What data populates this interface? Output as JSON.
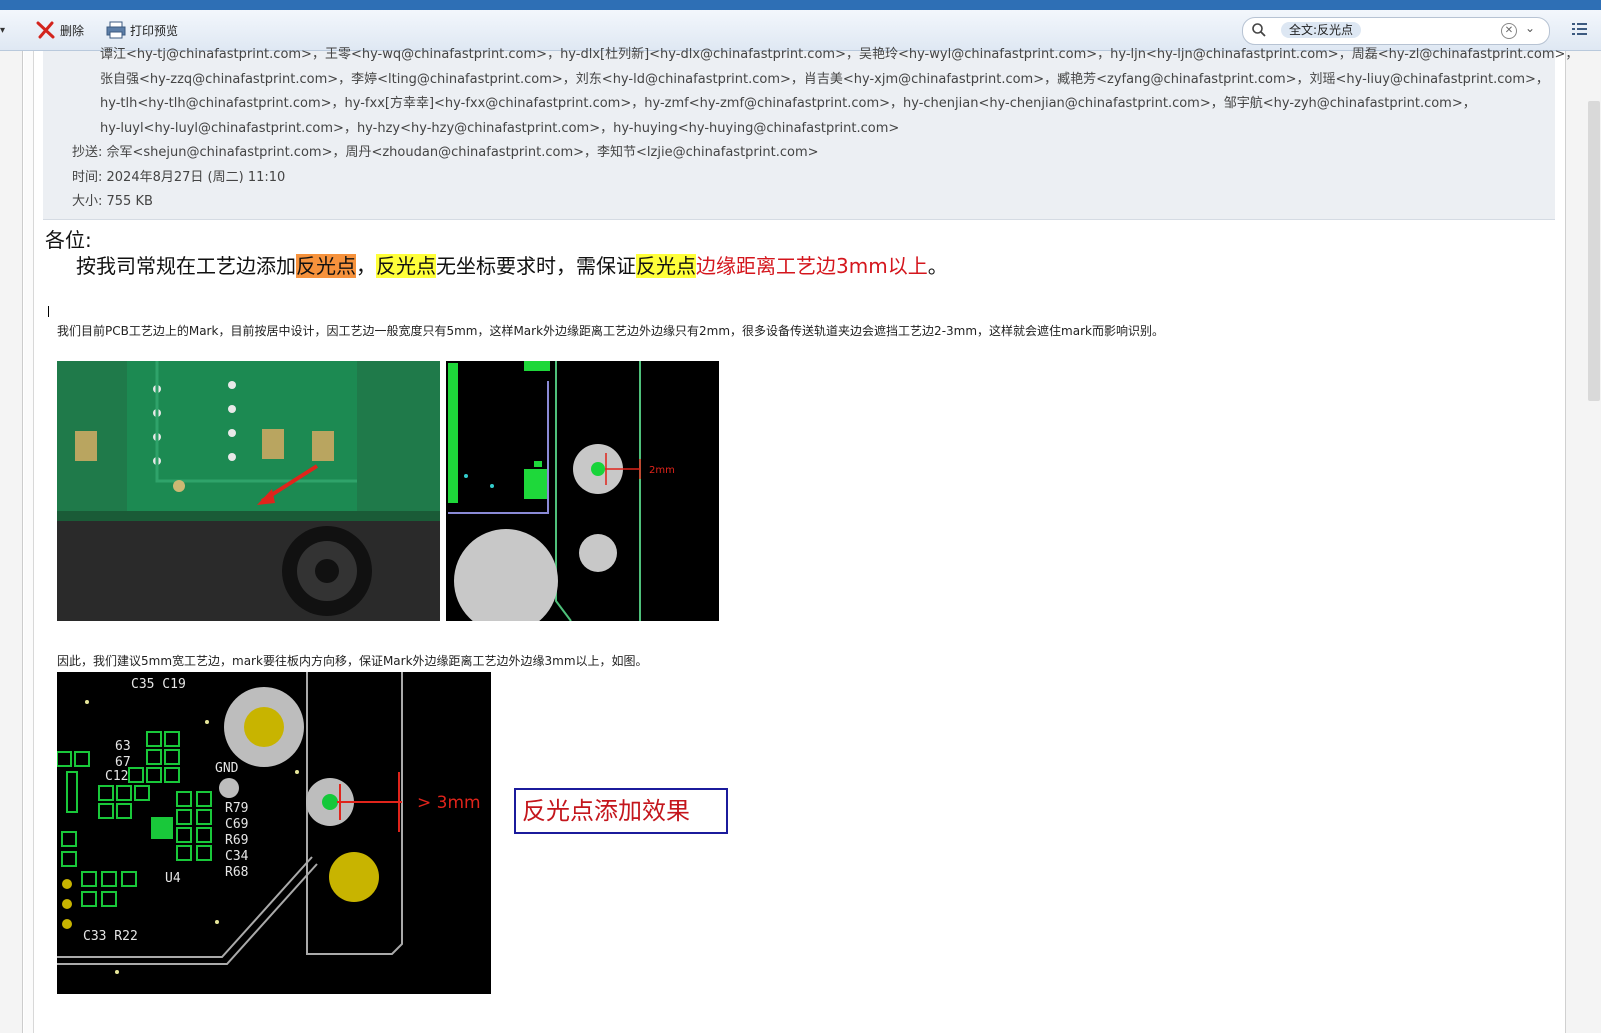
{
  "toolbar": {
    "delete_label": "删除",
    "print_preview_label": "打印预览",
    "search_value": "全文:反光点"
  },
  "header": {
    "to_line1": "谭江<hy-tj@chinafastprint.com>，王零<hy-wq@chinafastprint.com>，hy-dlx[杜列新]<hy-dlx@chinafastprint.com>，吴艳玲<hy-wyl@chinafastprint.com>，hy-ljn<hy-ljn@chinafastprint.com>，周磊<hy-zl@chinafastprint.com>，",
    "to_line2": "张自强<hy-zzq@chinafastprint.com>，李婷<lting@chinafastprint.com>，刘东<hy-ld@chinafastprint.com>，肖吉美<hy-xjm@chinafastprint.com>，臧艳芳<zyfang@chinafastprint.com>，刘瑶<hy-liuy@chinafastprint.com>，",
    "to_line3": "hy-tlh<hy-tlh@chinafastprint.com>，hy-fxx[方幸幸]<hy-fxx@chinafastprint.com>，hy-zmf<hy-zmf@chinafastprint.com>，hy-chenjian<hy-chenjian@chinafastprint.com>，邹宇航<hy-zyh@chinafastprint.com>，",
    "to_line4": "hy-luyl<hy-luyl@chinafastprint.com>，hy-hzy<hy-hzy@chinafastprint.com>，hy-huying<hy-huying@chinafastprint.com>",
    "cc": "抄送: 佘军<shejun@chinafastprint.com>，周丹<zhoudan@chinafastprint.com>，李知节<lzjie@chinafastprint.com>",
    "time": "时间: 2024年8月27日 (周二) 11:10",
    "size": "大小: 755 KB"
  },
  "body": {
    "greeting": "各位:",
    "l1_a": "按我司常规在工艺边添加",
    "l1_hl1": "反光点",
    "l1_b": "，",
    "l1_hl2": "反光点",
    "l1_c": "无坐标要求时，需保证",
    "l1_hl3": "反光点",
    "l1_red": "边缘距离工艺边3mm以上",
    "l1_end": "。",
    "para1": "我们目前PCB工艺边上的Mark，目前按居中设计，因工艺边一般宽度只有5mm，这样Mark外边缘距离工艺边外边缘只有2mm，很多设备传送轨道夹边会遮挡工艺边2-3mm，这样就会遮住mark而影响识别。",
    "para2": "因此，我们建议5mm宽工艺边，mark要往板内方向移，保证Mark外边缘距离工艺边外边缘3mm以上，如图。",
    "dim_2mm": "2mm",
    "dim_3mm": "> 3mm",
    "effect_label": "反光点添加效果",
    "silk_c35_c19": "C35 C19",
    "silk_gnd": "GND",
    "silk_u4": "U4",
    "silk_c33_r22": "C33 R22",
    "silk_r79": "R79",
    "silk_c69": "C69",
    "silk_r69": "R69",
    "silk_c34": "C34",
    "silk_r68": "R68",
    "silk_63": "63",
    "silk_67": "67",
    "silk_c12": "C12"
  }
}
